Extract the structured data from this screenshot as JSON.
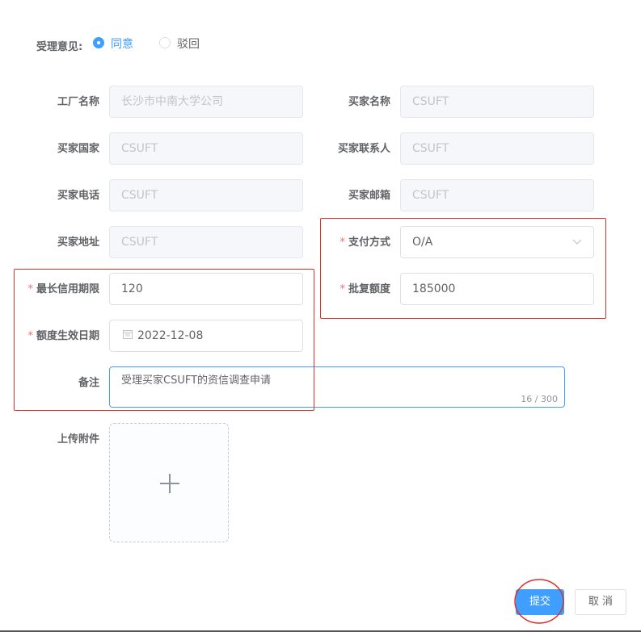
{
  "opinion": {
    "label": "受理意见:",
    "options": [
      {
        "label": "同意",
        "selected": true
      },
      {
        "label": "驳回",
        "selected": false
      }
    ]
  },
  "fields": {
    "factory_name": {
      "label": "工厂名称",
      "value": "长沙市中南大学公司"
    },
    "buyer_name": {
      "label": "买家名称",
      "value": "CSUFT"
    },
    "buyer_country": {
      "label": "买家国家",
      "value": "CSUFT"
    },
    "buyer_contact": {
      "label": "买家联系人",
      "value": "CSUFT"
    },
    "buyer_phone": {
      "label": "买家电话",
      "value": "CSUFT"
    },
    "buyer_email": {
      "label": "买家邮箱",
      "value": "CSUFT"
    },
    "buyer_address": {
      "label": "买家地址",
      "value": "CSUFT"
    },
    "payment_method": {
      "label": "支付方式",
      "value": "O/A",
      "required": true
    },
    "max_credit_period": {
      "label": "最长信用期限",
      "value": "120",
      "required": true
    },
    "approved_amount": {
      "label": "批复额度",
      "value": "185000",
      "required": true
    },
    "effective_date": {
      "label": "额度生效日期",
      "value": "2022-12-08",
      "required": true
    },
    "remark": {
      "label": "备注",
      "value": "受理买家CSUFT的资信调查申请",
      "counter": "16 / 300"
    },
    "attachment": {
      "label": "上传附件"
    }
  },
  "required_mark": "*",
  "buttons": {
    "submit": "提交",
    "cancel": "取 消"
  },
  "colors": {
    "primary": "#409eff",
    "annotation_red": "#d9312b",
    "required_red": "#f56c6c",
    "disabled_bg": "#f5f7fa"
  }
}
